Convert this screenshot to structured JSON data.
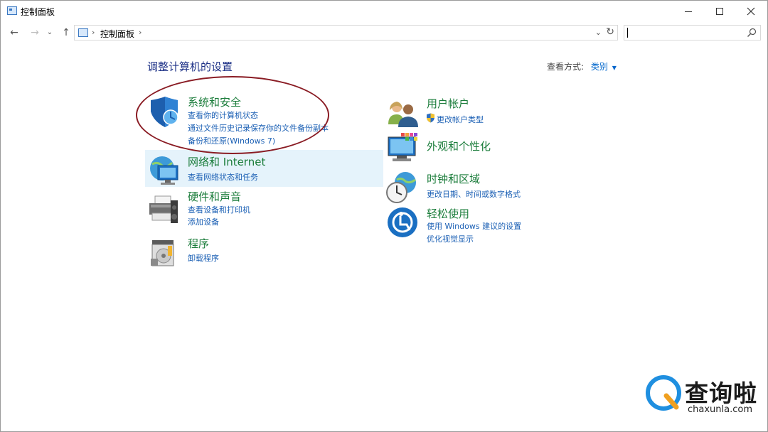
{
  "window": {
    "title": "控制面板"
  },
  "nav": {
    "back_glyph": "←",
    "forward_glyph": "→",
    "recent_glyph": "⌄",
    "up_glyph": "↑",
    "breadcrumb": "控制面板",
    "breadcrumb_sep": "›",
    "dropdown_glyph": "⌄",
    "refresh_glyph": "↻"
  },
  "search": {
    "value": "",
    "placeholder": ""
  },
  "content": {
    "heading": "调整计算机的设置",
    "view_by_label": "查看方式:",
    "view_by_value": "类别"
  },
  "categories": {
    "system_security": {
      "title": "系统和安全",
      "links": [
        "查看你的计算机状态",
        "通过文件历史记录保存你的文件备份副本",
        "备份和还原(Windows 7)"
      ]
    },
    "network": {
      "title": "网络和 Internet",
      "links": [
        "查看网络状态和任务"
      ]
    },
    "hardware": {
      "title": "硬件和声音",
      "links": [
        "查看设备和打印机",
        "添加设备"
      ]
    },
    "programs": {
      "title": "程序",
      "links": [
        "卸载程序"
      ]
    },
    "user_accounts": {
      "title": "用户帐户",
      "links": [
        "更改帐户类型"
      ]
    },
    "appearance": {
      "title": "外观和个性化",
      "links": []
    },
    "clock_region": {
      "title": "时钟和区域",
      "links": [
        "更改日期、时间或数字格式"
      ]
    },
    "ease_access": {
      "title": "轻松使用",
      "links": [
        "使用 Windows 建议的设置",
        "优化视觉显示"
      ]
    }
  },
  "watermark": {
    "cn": "查询啦",
    "en": "chaxunla.com"
  },
  "colors": {
    "category_title": "#1a7c3a",
    "link": "#1a5fb4",
    "heading": "#1e3287",
    "hover": "#e5f3fb",
    "annotation": "#8a1c24"
  }
}
